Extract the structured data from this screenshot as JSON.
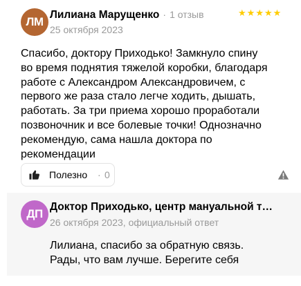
{
  "review": {
    "avatar_initials": "ЛМ",
    "avatar_color": "#b46631",
    "author": "Лилиана Марущенко",
    "separator": "·",
    "review_count": "1 отзыв",
    "rating": 5,
    "stars": [
      "★",
      "★",
      "★",
      "★",
      "★"
    ],
    "star_color": "#ffcc00",
    "date": "25 октября 2023",
    "text": "Спасибо, доктору Приходько! Замкнуло спину во время поднятия тяжелой коробки, благодаря работе с Александром Александровичем, с первого же раза стало легче ходить, дышать, работать. За три приема хорошо проработали позвоночник и все болевые точки! Однозначно рекомендую, сама нашла доктора по рекомендации",
    "helpful": {
      "icon": "thumbs-up-icon",
      "label": "Полезно",
      "separator": "·",
      "count": "0"
    },
    "report_icon": "warning-icon"
  },
  "reply": {
    "avatar_initials": "ДП",
    "avatar_color": "#c068c9",
    "author": "Доктор Приходько, центр мануальной т…",
    "date": "26 октября 2023, официальный ответ",
    "text": "Лилиана, спасибо за обратную связь. Рады, что вам лучше. Берегите себя"
  }
}
